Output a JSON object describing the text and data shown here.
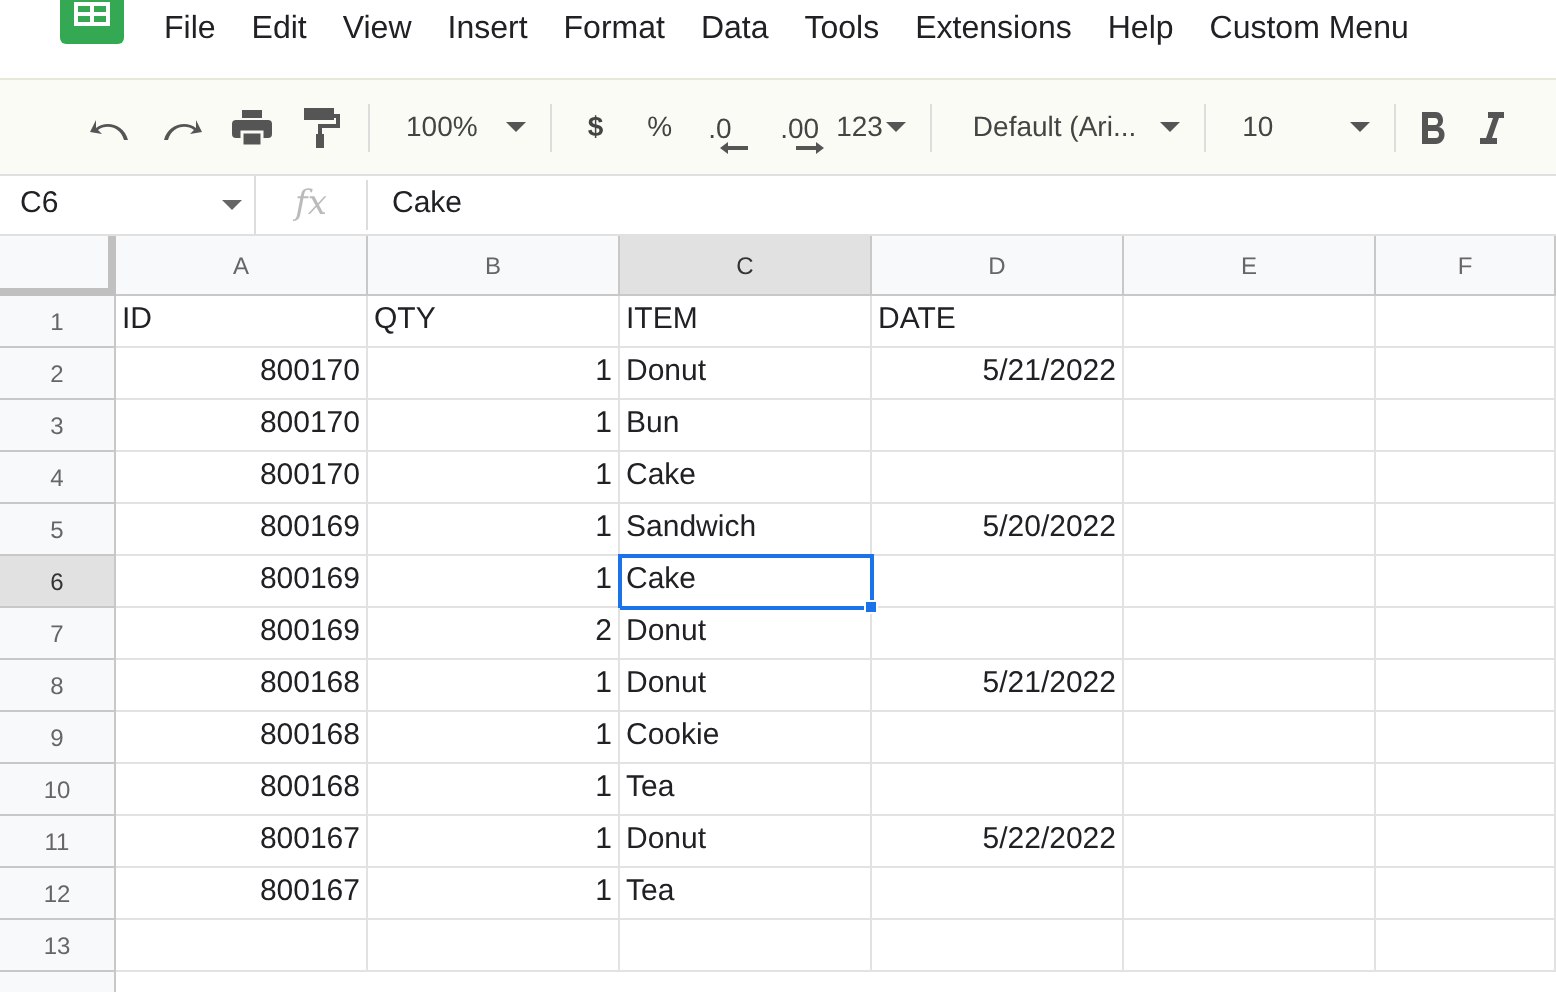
{
  "menu": [
    "File",
    "Edit",
    "View",
    "Insert",
    "Format",
    "Data",
    "Tools",
    "Extensions",
    "Help",
    "Custom Menu"
  ],
  "toolbar": {
    "zoom": "100%",
    "currency": "$",
    "percent": "%",
    "decrease_decimals": ".0",
    "increase_decimals": ".00",
    "number_format": "123",
    "font": "Default (Ari...",
    "font_size": "10"
  },
  "formula_bar": {
    "name_box": "C6",
    "fx": "fx",
    "value": "Cake"
  },
  "columns": [
    {
      "label": "A",
      "selected": false
    },
    {
      "label": "B",
      "selected": false
    },
    {
      "label": "C",
      "selected": true
    },
    {
      "label": "D",
      "selected": false
    },
    {
      "label": "E",
      "selected": false
    },
    {
      "label": "F",
      "selected": false
    }
  ],
  "rows": [
    {
      "number": "1",
      "selected": false,
      "cells": [
        "ID",
        "QTY",
        "ITEM",
        "DATE",
        "",
        ""
      ]
    },
    {
      "number": "2",
      "selected": false,
      "cells": [
        "800170",
        "1",
        "Donut",
        "5/21/2022",
        "",
        ""
      ]
    },
    {
      "number": "3",
      "selected": false,
      "cells": [
        "800170",
        "1",
        "Bun",
        "",
        "",
        ""
      ]
    },
    {
      "number": "4",
      "selected": false,
      "cells": [
        "800170",
        "1",
        "Cake",
        "",
        "",
        ""
      ]
    },
    {
      "number": "5",
      "selected": false,
      "cells": [
        "800169",
        "1",
        "Sandwich",
        "5/20/2022",
        "",
        ""
      ]
    },
    {
      "number": "6",
      "selected": true,
      "cells": [
        "800169",
        "1",
        "Cake",
        "",
        "",
        ""
      ]
    },
    {
      "number": "7",
      "selected": false,
      "cells": [
        "800169",
        "2",
        "Donut",
        "",
        "",
        ""
      ]
    },
    {
      "number": "8",
      "selected": false,
      "cells": [
        "800168",
        "1",
        "Donut",
        "5/21/2022",
        "",
        ""
      ]
    },
    {
      "number": "9",
      "selected": false,
      "cells": [
        "800168",
        "1",
        "Cookie",
        "",
        "",
        ""
      ]
    },
    {
      "number": "10",
      "selected": false,
      "cells": [
        "800168",
        "1",
        "Tea",
        "",
        "",
        ""
      ]
    },
    {
      "number": "11",
      "selected": false,
      "cells": [
        "800167",
        "1",
        "Donut",
        "5/22/2022",
        "",
        ""
      ]
    },
    {
      "number": "12",
      "selected": false,
      "cells": [
        "800167",
        "1",
        "Tea",
        "",
        "",
        ""
      ]
    },
    {
      "number": "13",
      "selected": false,
      "cells": [
        "",
        "",
        "",
        "",
        "",
        ""
      ]
    }
  ]
}
